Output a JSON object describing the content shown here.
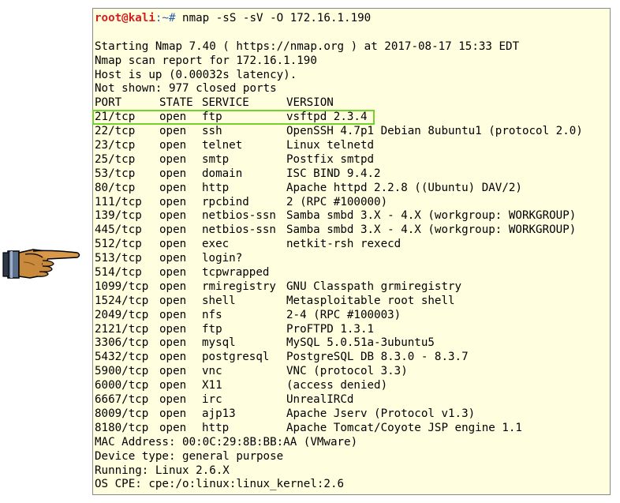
{
  "terminal": {
    "prompt_user": "root@kali",
    "prompt_path": ":~#",
    "command": " nmap -sS -sV -O 172.16.1.190",
    "intro_lines": [
      "",
      "Starting Nmap 7.40 ( https://nmap.org ) at 2017-08-17 15:33 EDT",
      "Nmap scan report for 172.16.1.190",
      "Host is up (0.00032s latency).",
      "Not shown: 977 closed ports"
    ],
    "headers": [
      "PORT",
      "STATE",
      "SERVICE",
      "VERSION"
    ],
    "rows": [
      {
        "port": "21/tcp",
        "state": "open",
        "service": "ftp",
        "version": "vsftpd 2.3.4"
      },
      {
        "port": "22/tcp",
        "state": "open",
        "service": "ssh",
        "version": "OpenSSH 4.7p1 Debian 8ubuntu1 (protocol 2.0)"
      },
      {
        "port": "23/tcp",
        "state": "open",
        "service": "telnet",
        "version": "Linux telnetd"
      },
      {
        "port": "25/tcp",
        "state": "open",
        "service": "smtp",
        "version": "Postfix smtpd"
      },
      {
        "port": "53/tcp",
        "state": "open",
        "service": "domain",
        "version": "ISC BIND 9.4.2"
      },
      {
        "port": "80/tcp",
        "state": "open",
        "service": "http",
        "version": "Apache httpd 2.2.8 ((Ubuntu) DAV/2)"
      },
      {
        "port": "111/tcp",
        "state": "open",
        "service": "rpcbind",
        "version": "2 (RPC #100000)"
      },
      {
        "port": "139/tcp",
        "state": "open",
        "service": "netbios-ssn",
        "version": "Samba smbd 3.X - 4.X (workgroup: WORKGROUP)"
      },
      {
        "port": "445/tcp",
        "state": "open",
        "service": "netbios-ssn",
        "version": "Samba smbd 3.X - 4.X (workgroup: WORKGROUP)"
      },
      {
        "port": "512/tcp",
        "state": "open",
        "service": "exec",
        "version": "netkit-rsh rexecd"
      },
      {
        "port": "513/tcp",
        "state": "open",
        "service": "login?",
        "version": ""
      },
      {
        "port": "514/tcp",
        "state": "open",
        "service": "tcpwrapped",
        "version": ""
      },
      {
        "port": "1099/tcp",
        "state": "open",
        "service": "rmiregistry",
        "version": "GNU Classpath grmiregistry"
      },
      {
        "port": "1524/tcp",
        "state": "open",
        "service": "shell",
        "version": "Metasploitable root shell"
      },
      {
        "port": "2049/tcp",
        "state": "open",
        "service": "nfs",
        "version": "2-4 (RPC #100003)"
      },
      {
        "port": "2121/tcp",
        "state": "open",
        "service": "ftp",
        "version": "ProFTPD 1.3.1"
      },
      {
        "port": "3306/tcp",
        "state": "open",
        "service": "mysql",
        "version": "MySQL 5.0.51a-3ubuntu5"
      },
      {
        "port": "5432/tcp",
        "state": "open",
        "service": "postgresql",
        "version": "PostgreSQL DB 8.3.0 - 8.3.7"
      },
      {
        "port": "5900/tcp",
        "state": "open",
        "service": "vnc",
        "version": "VNC (protocol 3.3)"
      },
      {
        "port": "6000/tcp",
        "state": "open",
        "service": "X11",
        "version": "(access denied)"
      },
      {
        "port": "6667/tcp",
        "state": "open",
        "service": "irc",
        "version": "UnrealIRCd"
      },
      {
        "port": "8009/tcp",
        "state": "open",
        "service": "ajp13",
        "version": "Apache Jserv (Protocol v1.3)"
      },
      {
        "port": "8180/tcp",
        "state": "open",
        "service": "http",
        "version": "Apache Tomcat/Coyote JSP engine 1.1"
      }
    ],
    "footer_lines": [
      "MAC Address: 00:0C:29:8B:BB:AA (VMware)",
      "Device type: general purpose",
      "Running: Linux 2.6.X",
      "OS CPE: cpe:/o:linux:linux_kernel:2.6"
    ]
  },
  "annotations": {
    "highlighted_row_port": "21/tcp",
    "pointer_icon": "pointing-hand-icon",
    "highlight_color": "#73d22b",
    "terminal_background": "#ffffe0",
    "prompt_user_color": "#d41e1e",
    "prompt_path_color": "#2b5fb0"
  }
}
